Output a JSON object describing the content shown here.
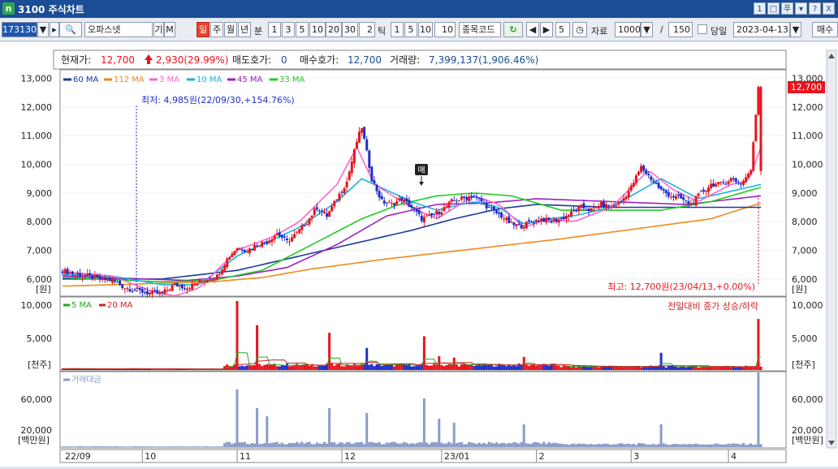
{
  "window": {
    "icon": "n",
    "title": "3100 주식차트",
    "buttons": [
      "1",
      "□",
      "푸",
      "▾",
      "?",
      "X"
    ]
  },
  "toolbar": {
    "code": "173130",
    "name": "오파스넷",
    "gi": "기",
    "m": "M",
    "periods": [
      "일",
      "주",
      "월",
      "년"
    ],
    "selected_period": "일",
    "bun_label": "분",
    "minutes": [
      "1",
      "3",
      "5",
      "10",
      "20",
      "30"
    ],
    "minute_input": "2",
    "tick_label": "틱",
    "ticks": [
      "1",
      "5",
      "10"
    ],
    "tick_input": "10",
    "search": "종목코드",
    "count_input": "5",
    "data_label": "자료",
    "data_count": "1000",
    "slash": "/",
    "range_count": "150",
    "today_label": "당일",
    "date": "2023-04-13",
    "action": "매수"
  },
  "info": {
    "price_label": "현재가:",
    "price": "12,700",
    "change": "2,930(29.99%)",
    "ask_label": "매도호가:",
    "ask": "0",
    "bid_label": "매수호가:",
    "bid": "12,700",
    "vol_label": "거래량:",
    "vol": "7,399,137(1,906.46%)"
  },
  "colors": {
    "up": "#e8141f",
    "down": "#1f2fc8",
    "ma60": "#1a3a9c",
    "ma112": "#f08a1c",
    "ma3": "#ff66cc",
    "ma10": "#1ab4e0",
    "ma45": "#a020c0",
    "ma33": "#22cc22",
    "vol5": "#22aa22",
    "vol20": "#cc2222",
    "amount": "#8a9cc8"
  },
  "chart_data": [
    {
      "type": "candlestick",
      "title": "",
      "ylabel": "원",
      "ylim": [
        5400,
        13300
      ],
      "yticks": [
        "13,000",
        "12,000",
        "11,000",
        "10,000",
        "9,000",
        "8,000",
        "7,000",
        "6,000"
      ],
      "legend": [
        "60 MA",
        "112 MA",
        "3 MA",
        "10 MA",
        "45 MA",
        "33 MA"
      ],
      "x_labels": [
        "22/09",
        "10",
        "11",
        "12",
        "23/01",
        "2",
        "3",
        "4"
      ],
      "last_price": "12,700",
      "annotations": {
        "low": "최저: 4,985원(22/09/30,+154.76%)",
        "high": "최고: 12,700원(23/04/13,+0.00%)",
        "marker": "매"
      },
      "ma_key_points": {
        "ma60": [
          [
            0,
            6000
          ],
          [
            40,
            6000
          ],
          [
            70,
            6300
          ],
          [
            100,
            6900
          ],
          [
            120,
            7300
          ],
          [
            140,
            7700
          ],
          [
            157,
            8100
          ],
          [
            175,
            8450
          ],
          [
            190,
            8600
          ],
          [
            220,
            8500
          ],
          [
            280,
            8500
          ]
        ],
        "ma112": [
          [
            0,
            5750
          ],
          [
            60,
            5900
          ],
          [
            80,
            6050
          ],
          [
            100,
            6350
          ],
          [
            130,
            6700
          ],
          [
            170,
            7100
          ],
          [
            200,
            7400
          ],
          [
            230,
            7750
          ],
          [
            260,
            8100
          ],
          [
            280,
            8650
          ]
        ],
        "ma33": [
          [
            0,
            6050
          ],
          [
            40,
            5900
          ],
          [
            60,
            5950
          ],
          [
            80,
            6300
          ],
          [
            100,
            7200
          ],
          [
            120,
            8100
          ],
          [
            135,
            8600
          ],
          [
            150,
            8900
          ],
          [
            165,
            9000
          ],
          [
            180,
            8900
          ],
          [
            200,
            8400
          ],
          [
            215,
            8400
          ],
          [
            240,
            8400
          ],
          [
            260,
            8700
          ],
          [
            280,
            9200
          ]
        ],
        "ma45": [
          [
            0,
            6100
          ],
          [
            50,
            5950
          ],
          [
            70,
            6100
          ],
          [
            90,
            6400
          ],
          [
            110,
            7200
          ],
          [
            130,
            8200
          ],
          [
            150,
            8600
          ],
          [
            170,
            8650
          ],
          [
            190,
            8800
          ],
          [
            220,
            8700
          ],
          [
            250,
            8600
          ],
          [
            280,
            8900
          ]
        ],
        "ma10": [
          [
            0,
            6150
          ],
          [
            20,
            6100
          ],
          [
            40,
            5800
          ],
          [
            55,
            5800
          ],
          [
            70,
            6800
          ],
          [
            85,
            7400
          ],
          [
            95,
            7800
          ],
          [
            110,
            8700
          ],
          [
            120,
            9500
          ],
          [
            130,
            9100
          ],
          [
            140,
            8700
          ],
          [
            150,
            8400
          ],
          [
            165,
            8700
          ],
          [
            175,
            8500
          ],
          [
            185,
            7900
          ],
          [
            195,
            8100
          ],
          [
            205,
            8200
          ],
          [
            220,
            8500
          ],
          [
            240,
            9500
          ],
          [
            255,
            8800
          ],
          [
            270,
            9100
          ],
          [
            280,
            9300
          ]
        ],
        "ma3": [
          [
            0,
            6250
          ],
          [
            20,
            6100
          ],
          [
            35,
            5600
          ],
          [
            45,
            5400
          ],
          [
            55,
            5700
          ],
          [
            70,
            7000
          ],
          [
            85,
            7500
          ],
          [
            95,
            8000
          ],
          [
            110,
            9300
          ],
          [
            118,
            10600
          ],
          [
            125,
            9300
          ],
          [
            140,
            8500
          ],
          [
            150,
            8100
          ],
          [
            165,
            8900
          ],
          [
            175,
            8600
          ],
          [
            185,
            7800
          ],
          [
            195,
            8100
          ],
          [
            205,
            8000
          ],
          [
            220,
            8500
          ],
          [
            235,
            9800
          ],
          [
            245,
            9100
          ],
          [
            255,
            8700
          ],
          [
            268,
            9300
          ],
          [
            275,
            9400
          ],
          [
            280,
            10600
          ]
        ]
      },
      "closes": [
        [
          0,
          6300
        ],
        [
          5,
          6150
        ],
        [
          10,
          6100
        ],
        [
          15,
          6000
        ],
        [
          20,
          5950
        ],
        [
          25,
          5700
        ],
        [
          30,
          5600
        ],
        [
          35,
          5500
        ],
        [
          40,
          5500
        ],
        [
          45,
          5800
        ],
        [
          50,
          5700
        ],
        [
          55,
          5900
        ],
        [
          58,
          6000
        ],
        [
          62,
          6100
        ],
        [
          66,
          6700
        ],
        [
          70,
          7100
        ],
        [
          74,
          7000
        ],
        [
          78,
          7200
        ],
        [
          82,
          7300
        ],
        [
          86,
          7600
        ],
        [
          90,
          7300
        ],
        [
          94,
          7600
        ],
        [
          98,
          8000
        ],
        [
          102,
          8500
        ],
        [
          106,
          8200
        ],
        [
          110,
          8800
        ],
        [
          114,
          9400
        ],
        [
          118,
          10800
        ],
        [
          120,
          11300
        ],
        [
          124,
          9500
        ],
        [
          128,
          8700
        ],
        [
          132,
          8600
        ],
        [
          136,
          8800
        ],
        [
          140,
          8500
        ],
        [
          144,
          8100
        ],
        [
          148,
          8200
        ],
        [
          152,
          8400
        ],
        [
          156,
          8700
        ],
        [
          160,
          8800
        ],
        [
          164,
          8900
        ],
        [
          168,
          8700
        ],
        [
          172,
          8400
        ],
        [
          176,
          8200
        ],
        [
          180,
          7900
        ],
        [
          184,
          7850
        ],
        [
          188,
          8000
        ],
        [
          192,
          8100
        ],
        [
          196,
          8000
        ],
        [
          200,
          8100
        ],
        [
          204,
          8300
        ],
        [
          208,
          8500
        ],
        [
          212,
          8400
        ],
        [
          216,
          8600
        ],
        [
          220,
          8500
        ],
        [
          224,
          8700
        ],
        [
          228,
          9200
        ],
        [
          232,
          9900
        ],
        [
          236,
          9500
        ],
        [
          240,
          9100
        ],
        [
          244,
          8900
        ],
        [
          248,
          8800
        ],
        [
          252,
          8600
        ],
        [
          256,
          9000
        ],
        [
          260,
          9300
        ],
        [
          264,
          9300
        ],
        [
          268,
          9500
        ],
        [
          272,
          9300
        ],
        [
          276,
          9800
        ],
        [
          279,
          12700
        ]
      ]
    },
    {
      "type": "bar",
      "title": "",
      "ylabel": "천주",
      "ylim": [
        0,
        10000
      ],
      "yticks": [
        "10,000",
        "5,000"
      ],
      "legend": [
        "5 MA",
        "20 MA"
      ],
      "note": "전일대비 종가 상승/하락",
      "spikes": [
        [
          70,
          10000
        ],
        [
          78,
          6500
        ],
        [
          107,
          5400
        ],
        [
          122,
          3200
        ],
        [
          145,
          4900
        ],
        [
          151,
          2000
        ],
        [
          157,
          1800
        ],
        [
          185,
          1900
        ],
        [
          240,
          2500
        ],
        [
          279,
          7400
        ]
      ]
    },
    {
      "type": "bar",
      "title": "",
      "ylabel": "백만원",
      "ylim": [
        0,
        90000
      ],
      "yticks": [
        "60,000",
        "20,000"
      ],
      "legend": [
        "거래대금"
      ],
      "spikes": [
        [
          70,
          71000
        ],
        [
          78,
          48000
        ],
        [
          82,
          38000
        ],
        [
          107,
          48000
        ],
        [
          122,
          42000
        ],
        [
          145,
          60000
        ],
        [
          151,
          35000
        ],
        [
          157,
          30000
        ],
        [
          185,
          28000
        ],
        [
          240,
          28000
        ],
        [
          279,
          92000
        ]
      ]
    }
  ]
}
